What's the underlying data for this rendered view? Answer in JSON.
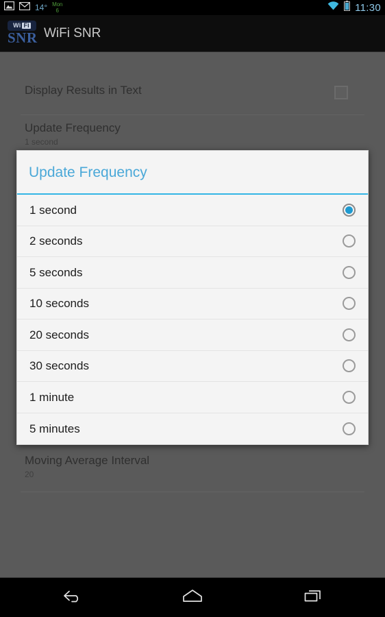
{
  "statusbar": {
    "icons": [
      "photo-icon",
      "envelope-icon"
    ],
    "temperature": "14°",
    "date_day": "Mon",
    "date_num": "6",
    "wifi_icon": "wifi-icon",
    "battery_icon": "battery-icon",
    "clock": "11:30",
    "temp_color": "#6fa8c8",
    "date_color": "#4e9a3a",
    "clock_color": "#8ec8e8"
  },
  "actionbar": {
    "logo_top_wi": "Wi",
    "logo_top_fi": "Fi",
    "logo_bottom": "SNR",
    "title": "WiFi SNR",
    "background": "#0d0d0d"
  },
  "settings": {
    "items": [
      {
        "title": "Display Results in Text",
        "summary": "",
        "control": "checkbox",
        "checked": false
      },
      {
        "title": "Update Frequency",
        "summary": "1 second",
        "control": "none",
        "checked": false
      },
      {
        "title": "Moving Average Interval",
        "summary": "20",
        "control": "none",
        "checked": false
      }
    ]
  },
  "dialog": {
    "title": "Update Frequency",
    "accent_color": "#33b5e5",
    "selected_index": 0,
    "options": [
      {
        "label": "1 second"
      },
      {
        "label": "2 seconds"
      },
      {
        "label": "5 seconds"
      },
      {
        "label": "10 seconds"
      },
      {
        "label": "20 seconds"
      },
      {
        "label": "30 seconds"
      },
      {
        "label": "1 minute"
      },
      {
        "label": "5 minutes"
      }
    ]
  },
  "navbar": {
    "buttons": [
      {
        "name": "back-button",
        "icon": "back-arrow-icon"
      },
      {
        "name": "home-button",
        "icon": "home-icon"
      },
      {
        "name": "recents-button",
        "icon": "recents-icon"
      }
    ]
  }
}
